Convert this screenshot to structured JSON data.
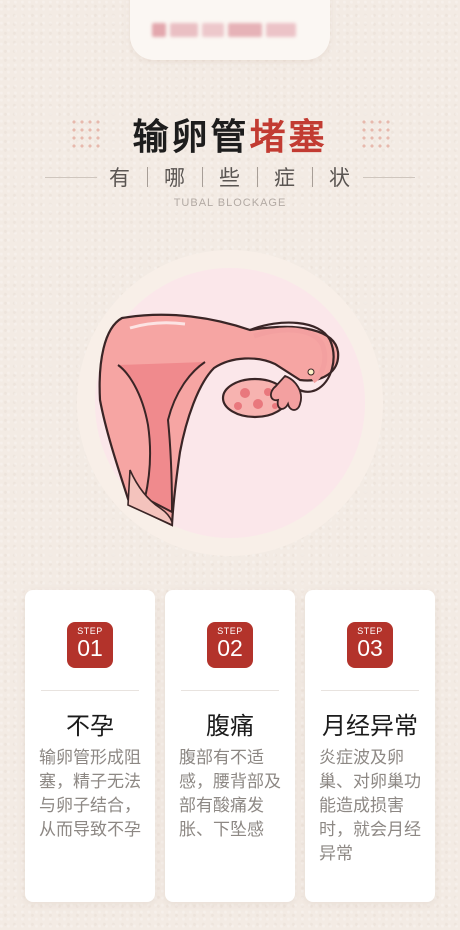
{
  "title": {
    "main": "输卵管",
    "accent": "堵塞"
  },
  "subtitle": {
    "words": [
      "有",
      "哪",
      "些",
      "症",
      "状"
    ]
  },
  "english_subtitle": "TUBAL BLOCKAGE",
  "colors": {
    "accent": "#c23b32",
    "badge": "#b3332b",
    "background": "#f3ebe4"
  },
  "cards": [
    {
      "step": "STEP",
      "number": "01",
      "title": "不孕",
      "text": "输卵管形成阻塞，精子无法与卵子结合，从而导致不孕"
    },
    {
      "step": "STEP",
      "number": "02",
      "title": "腹痛",
      "text": "腹部有不适感，腰背部及部有酸痛发胀、下坠感"
    },
    {
      "step": "STEP",
      "number": "03",
      "title": "月经异常",
      "text": "炎症波及卵巢、对卵巢功能造成损害时，就会月经异常"
    }
  ]
}
